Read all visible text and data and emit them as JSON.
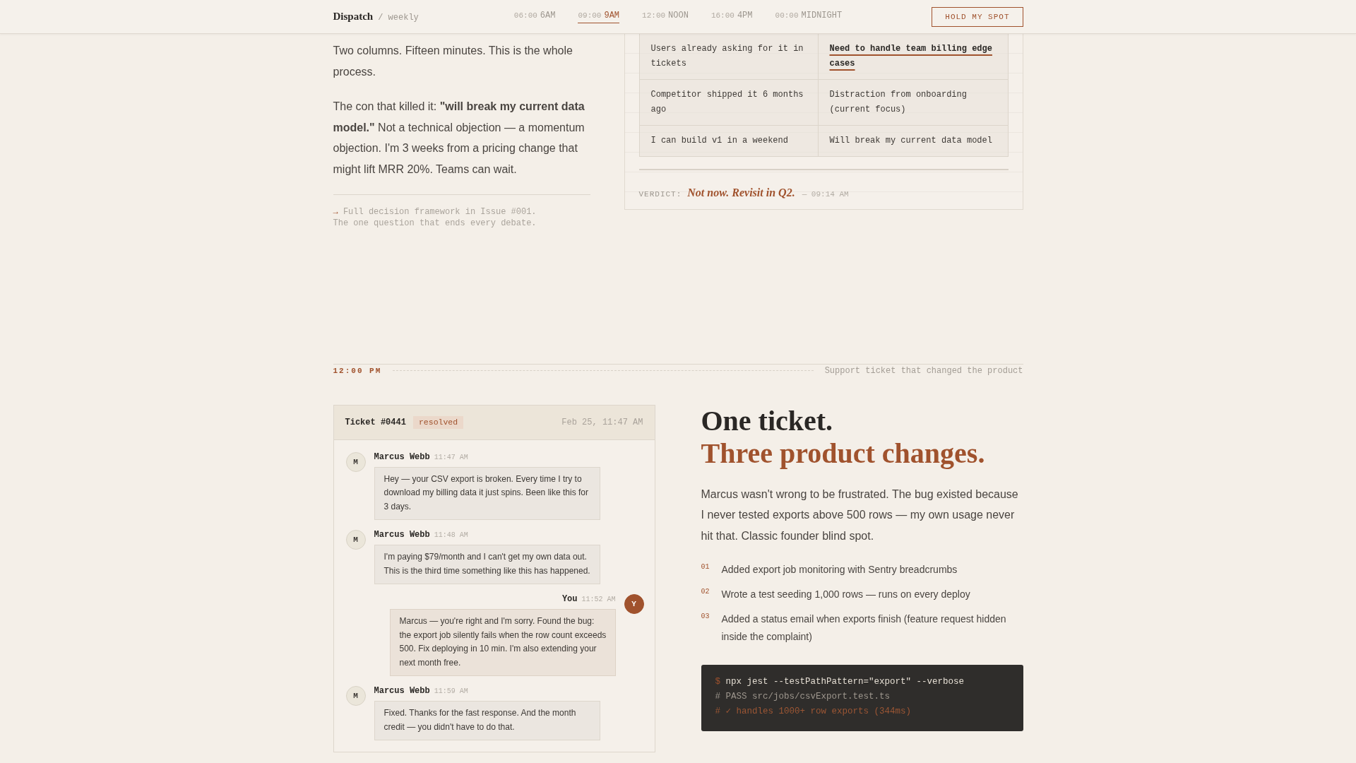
{
  "nav": {
    "logo": "Dispatch",
    "edition": "/ weekly",
    "items": [
      {
        "time": "06:00",
        "label": "6AM",
        "selected": false
      },
      {
        "time": "09:00",
        "label": "9AM",
        "selected": true
      },
      {
        "time": "12:00",
        "label": "NOON",
        "selected": false
      },
      {
        "time": "16:00",
        "label": "4PM",
        "selected": false
      },
      {
        "time": "00:00",
        "label": "MIDNIGHT",
        "selected": false
      }
    ],
    "cta": "HOLD MY SPOT"
  },
  "morning": {
    "paragraphs": [
      "Two columns. Fifteen minutes. This is the whole process.",
      "The con that killed it: **\"will break my current data model.\"** Not a technical objection — a momentum objection. I'm 3 weeks from a pricing change that might lift MRR 20%. Teams can wait."
    ],
    "footnote": {
      "arrow": "→",
      "lines": [
        "Full decision framework in Issue #001.",
        "The one question that ends every debate."
      ]
    },
    "decision_card": {
      "rows": [
        {
          "pro": {
            "text": "Users already asking for it in tickets",
            "highlighted": false
          },
          "con": {
            "text": "Need to handle team billing edge cases",
            "highlighted": true
          }
        },
        {
          "pro": {
            "text": "Competitor shipped it 6 months ago",
            "highlighted": false
          },
          "con": {
            "text": "Distraction from onboarding (current focus)",
            "highlighted": false
          }
        },
        {
          "pro": {
            "text": "I can build v1 in a weekend",
            "highlighted": false
          },
          "con": {
            "text": "Will break my current data model",
            "highlighted": false
          }
        }
      ],
      "verdict": {
        "label": "VERDICT:",
        "text": "Not now. Revisit in Q2.",
        "time": "— 09:14 AM"
      }
    }
  },
  "noon": {
    "divider": {
      "time": "12:00 PM",
      "caption": "Support ticket that changed the product"
    },
    "ticket": {
      "title": "Ticket #0441",
      "status": "resolved",
      "date": "Feb 25, 11:47 AM",
      "messages": [
        {
          "kind": "customer",
          "initial": "M",
          "author": "Marcus Webb",
          "time": "11:47 AM",
          "text": "Hey — your CSV export is broken. Every time I try to download my billing data it just spins. Been like this for 3 days."
        },
        {
          "kind": "customer",
          "initial": "M",
          "author": "Marcus Webb",
          "time": "11:48 AM",
          "text": "I'm paying $79/month and I can't get my own data out. This is the third time something like this has happened."
        },
        {
          "kind": "self",
          "initial": "Y",
          "author": "You",
          "time": "11:52 AM",
          "text": "Marcus — you're right and I'm sorry. Found the bug: the export job silently fails when the row count exceeds 500. Fix deploying in 10 min. I'm also extending your next month free."
        },
        {
          "kind": "customer",
          "initial": "M",
          "author": "Marcus Webb",
          "time": "11:59 AM",
          "text": "Fixed. Thanks for the fast response. And the month credit — you didn't have to do that."
        }
      ]
    },
    "headline": {
      "lead": "One ticket.",
      "accent": "Three product changes."
    },
    "body": "Marcus wasn't wrong to be frustrated. The bug existed because I never tested exports above 500 rows — my own usage never hit that. Classic founder blind spot.",
    "changes": [
      {
        "number": "01",
        "text": "Added export job monitoring with Sentry breadcrumbs"
      },
      {
        "number": "02",
        "text": "Wrote a test seeding 1,000 rows — runs on every deploy"
      },
      {
        "number": "03",
        "text": "Added a status email when exports finish (feature request hidden inside the complaint)"
      }
    ],
    "terminal": {
      "lines": [
        {
          "kind": "command",
          "prompt": "$",
          "text": "npx jest --testPathPattern=\"export\" --verbose"
        },
        {
          "kind": "comment",
          "text": "# PASS src/jobs/csvExport.test.ts"
        },
        {
          "kind": "success",
          "text": "# ✓ handles 1000+ row exports (344ms)"
        }
      ]
    }
  }
}
